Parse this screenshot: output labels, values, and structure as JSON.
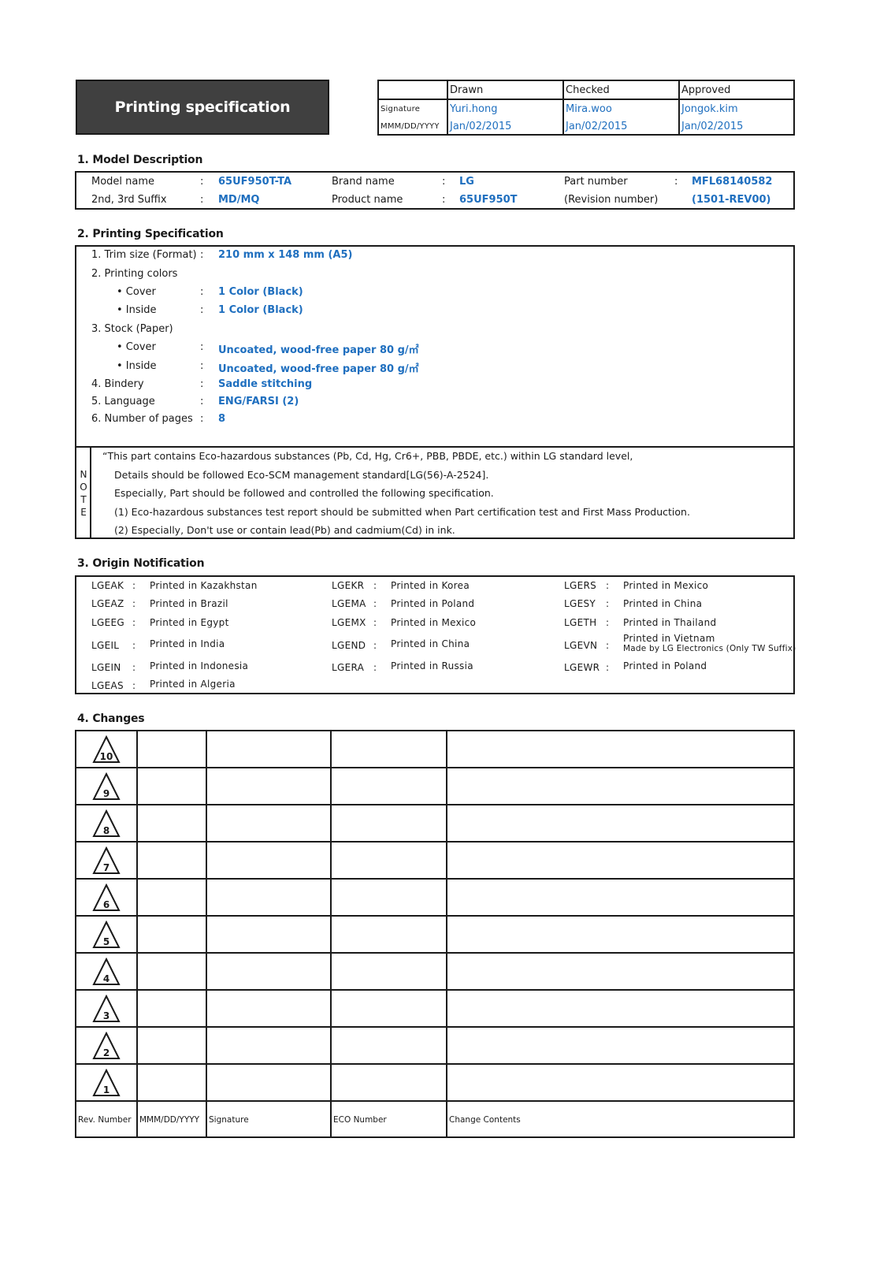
{
  "header": {
    "title": "Printing specification",
    "approval": {
      "columns": [
        "Drawn",
        "Checked",
        "Approved"
      ],
      "signature_label": "Signature",
      "date_label": "MMM/DD/YYYY",
      "signatures": [
        "Yuri.hong",
        "Mira.woo",
        "Jongok.kim"
      ],
      "dates": [
        "Jan/02/2015",
        "Jan/02/2015",
        "Jan/02/2015"
      ]
    }
  },
  "model_description": {
    "title": "1. Model Description",
    "separator": ":",
    "fields": [
      {
        "label": "Model name",
        "value": "65UF950T-TA"
      },
      {
        "label": "Brand name",
        "value": "LG"
      },
      {
        "label": "Part number",
        "value": "MFL68140582"
      },
      {
        "label": "2nd, 3rd Suffix",
        "value": "MD/MQ"
      },
      {
        "label": "Product name",
        "value": "65UF950T"
      },
      {
        "label": "(Revision number)",
        "value": "(1501-REV00)"
      }
    ]
  },
  "printing_specification": {
    "title": "2. Printing Specification",
    "separator": ":",
    "items": [
      {
        "label": "1. Trim size (Format)",
        "value": "210 mm x 148 mm (A5)"
      },
      {
        "label": "2. Printing colors",
        "value": ""
      },
      {
        "label": "• Cover",
        "value": "1 Color (Black)"
      },
      {
        "label": "• Inside",
        "value": "1 Color (Black)"
      },
      {
        "label": "3. Stock (Paper)",
        "value": ""
      },
      {
        "label": "• Cover",
        "value": "Uncoated, wood-free paper 80 g/㎡"
      },
      {
        "label": "• Inside",
        "value": "Uncoated, wood-free paper 80 g/㎡"
      },
      {
        "label": "4. Bindery",
        "value": "Saddle stitching"
      },
      {
        "label": "5. Language",
        "value": "ENG/FARSI (2)"
      },
      {
        "label": "6. Number of pages",
        "value": "8"
      }
    ],
    "note": {
      "letters": [
        "N",
        "O",
        "T",
        "E"
      ],
      "lines": [
        "“This part contains Eco-hazardous substances (Pb, Cd, Hg, Cr6+, PBB, PBDE, etc.) within LG standard level,",
        "Details should be followed Eco-SCM management standard[LG(56)-A-2524].",
        "Especially, Part should be followed and controlled the following specification.",
        "(1) Eco-hazardous substances test report should be submitted when Part certification test and First Mass Production.",
        "(2) Especially, Don't use or contain lead(Pb) and cadmium(Cd) in ink."
      ]
    }
  },
  "origin_notification": {
    "title": "3. Origin Notification",
    "separator": ":",
    "columns": [
      [
        {
          "code": "LGEAK",
          "text": "Printed in Kazakhstan"
        },
        {
          "code": "LGEAZ",
          "text": "Printed in Brazil"
        },
        {
          "code": "LGEEG",
          "text": "Printed in Egypt"
        },
        {
          "code": "LGEIL",
          "text": "Printed in India"
        },
        {
          "code": "LGEIN",
          "text": "Printed in Indonesia"
        },
        {
          "code": "LGEAS",
          "text": "Printed in Algeria"
        }
      ],
      [
        {
          "code": "LGEKR",
          "text": "Printed in Korea"
        },
        {
          "code": "LGEMA",
          "text": "Printed in Poland"
        },
        {
          "code": "LGEMX",
          "text": "Printed in Mexico"
        },
        {
          "code": "LGEND",
          "text": "Printed in China"
        },
        {
          "code": "LGERA",
          "text": "Printed in Russia"
        }
      ],
      [
        {
          "code": "LGERS",
          "text": "Printed in Mexico"
        },
        {
          "code": "LGESY",
          "text": "Printed in China"
        },
        {
          "code": "LGETH",
          "text": "Printed in Thailand"
        },
        {
          "code": "LGEVN",
          "text": "Printed in Vietnam",
          "subtext": "Made by LG Electronics (Only TW Suffix)"
        },
        {
          "code": "LGEWR",
          "text": "Printed in Poland"
        }
      ]
    ]
  },
  "changes": {
    "title": "4. Changes",
    "revisions": [
      "10",
      "9",
      "8",
      "7",
      "6",
      "5",
      "4",
      "3",
      "2",
      "1"
    ],
    "footer": [
      "Rev. Number",
      "MMM/DD/YYYY",
      "Signature",
      "ECO Number",
      "Change Contents"
    ]
  }
}
